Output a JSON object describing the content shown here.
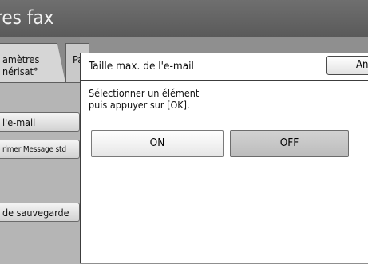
{
  "header": {
    "title": "res fax"
  },
  "tabs": [
    {
      "label_line1": "amètres",
      "label_line2": "nérisat°"
    },
    {
      "label": "Pa"
    }
  ],
  "sidebar": {
    "items": [
      {
        "label": "l'e-mail"
      },
      {
        "label": "rimer Message std"
      },
      {
        "label": "de sauvegarde"
      }
    ]
  },
  "dialog": {
    "title": "Taille max. de l'e-mail",
    "cancel_label": "Annuler",
    "instruction_line1": "Sélectionner un élément",
    "instruction_line2": "puis appuyer sur [OK].",
    "options": [
      {
        "label": "ON",
        "selected": false
      },
      {
        "label": "OFF",
        "selected": true
      }
    ]
  },
  "colors": {
    "title_bar": "#5f5f5f",
    "background": "#8f8f8f",
    "dialog": "#ffffff",
    "selected_option": "#c4c4c4"
  }
}
